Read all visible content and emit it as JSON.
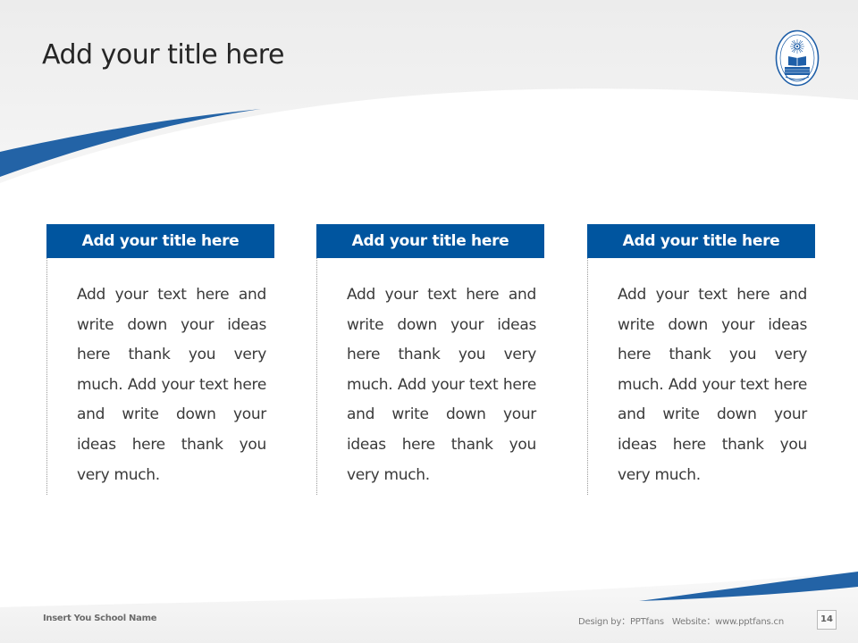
{
  "slide": {
    "title": "Add your title here",
    "logo_label": "university-seal",
    "columns": [
      {
        "title": "Add your title here",
        "text": "Add your text here and write down your ideas here thank you very much. Add your text here and write down your ideas here thank you very much."
      },
      {
        "title": "Add your title here",
        "text": "Add your text here and write down your ideas here thank you very much. Add your text here and write down your ideas here thank you very much."
      },
      {
        "title": "Add your title here",
        "text": "Add your text here and write down your ideas here thank you very much. Add your text here and write down your ideas here thank you very much."
      }
    ]
  },
  "footer": {
    "school_name": "Insert You School Name",
    "credit": "Design by：PPTfans   Website：www.pptfans.cn",
    "page_number": "14"
  },
  "colors": {
    "accent_blue": "#00559f",
    "swoosh_blue": "#2363a6",
    "header_gray": "#f0f0f0",
    "body_text": "#3a3a3a"
  }
}
